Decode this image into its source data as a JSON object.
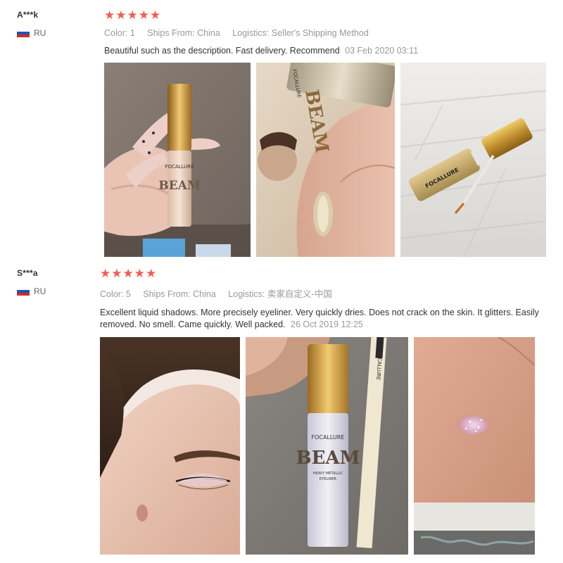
{
  "reviews": [
    {
      "user": "A***k",
      "country": "RU",
      "rating": 5,
      "color_label": "Color:",
      "color": "1",
      "ships_label": "Ships From:",
      "ships_from": "China",
      "logistics_label": "Logistics:",
      "logistics": "Seller's Shipping Method",
      "text": "Beautiful such as the description. Fast delivery. Recommend",
      "date": "03 Feb 2020 03:11",
      "photos": [
        {
          "name": "photo-hand-holding-beam-eyeliner",
          "label": "FOCALLURE BEAM"
        },
        {
          "name": "photo-glitter-swatch-on-hand",
          "label": "FOCALLURE BEAM"
        },
        {
          "name": "photo-open-eyeliner-bottle",
          "label": "FOCALLURE"
        }
      ]
    },
    {
      "user": "S***a",
      "country": "RU",
      "rating": 5,
      "color_label": "Color:",
      "color": "5",
      "ships_label": "Ships From:",
      "ships_from": "China",
      "logistics_label": "Logistics:",
      "logistics": "卖家自定义-中国",
      "text": "Excellent liquid shadows. More precisely eyeliner. Very quickly dries. Does not crack on the skin. It glitters. Easily removed. No smell. Came quickly. Well packed.",
      "date": "26 Oct 2019 12:25",
      "photos": [
        {
          "name": "photo-eye-makeup-applied",
          "label": ""
        },
        {
          "name": "photo-beam-eyeliner-and-pen",
          "label": "FOCALLURE BEAM HEAVY METALLIC EYELINER"
        },
        {
          "name": "photo-pink-glitter-swatch",
          "label": ""
        }
      ]
    }
  ],
  "colors": {
    "star": "#f45c4e",
    "meta": "#999999",
    "text": "#333333"
  }
}
